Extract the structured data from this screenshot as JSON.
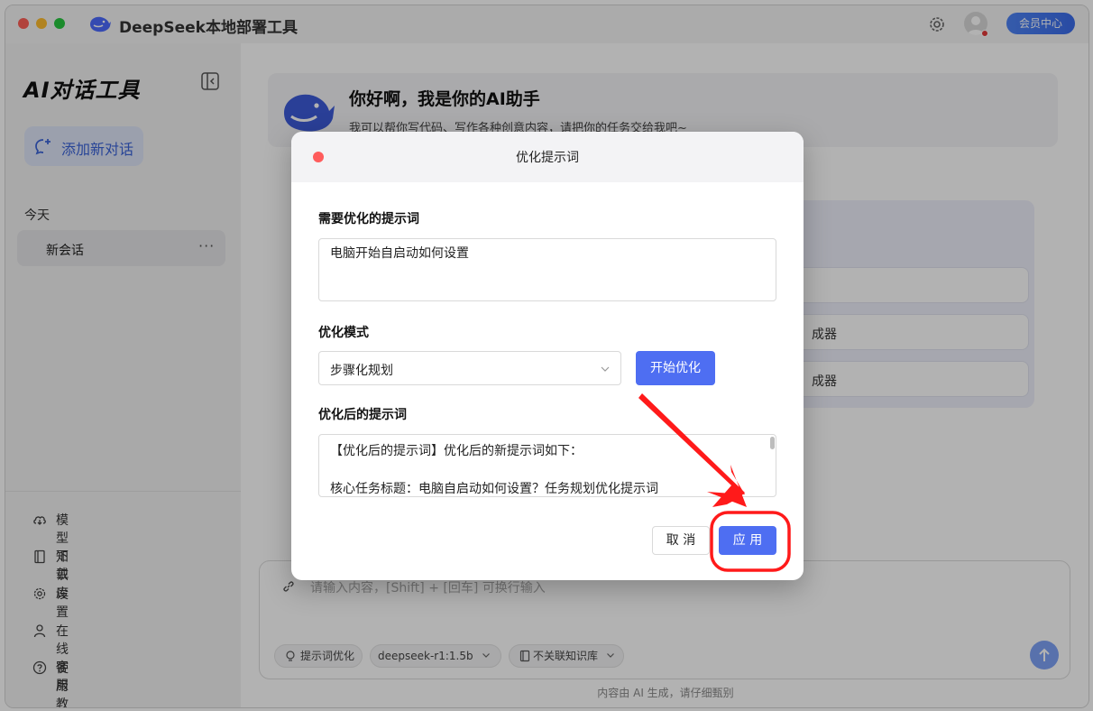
{
  "app": {
    "title": "DeepSeek本地部署工具",
    "vip_label": "会员中心"
  },
  "sidebar": {
    "title": "AI对话工具",
    "new_chat_label": "添加新对话",
    "group_label": "今天",
    "sessions": [
      {
        "label": "新会话",
        "more": "···"
      }
    ],
    "menu": [
      {
        "label": "模型下载",
        "icon": "cloud-download-icon"
      },
      {
        "label": "知识库",
        "icon": "book-icon"
      },
      {
        "label": "设置",
        "icon": "gear-icon"
      },
      {
        "label": "在线客服",
        "icon": "user-icon"
      },
      {
        "label": "使用教程",
        "icon": "help-icon"
      }
    ]
  },
  "main": {
    "welcome_title": "你好啊，我是你的AI助手",
    "welcome_subtitle": "我可以帮你写代码、写作各种创意内容，请把你的任务交给我吧~",
    "suggestions": [
      "成器",
      "成器"
    ],
    "input_placeholder": "请输入内容，[Shift] + [回车] 可换行输入",
    "chips": {
      "prompt_opt": "提示词优化",
      "model": "deepseek-r1:1.5b",
      "knowledge": "不关联知识库"
    },
    "footer_note": "内容由 AI 生成，请仔细甄别"
  },
  "modal": {
    "title": "优化提示词",
    "prompt_label": "需要优化的提示词",
    "prompt_value": "电脑开始自启动如何设置",
    "mode_label": "优化模式",
    "mode_value": "步骤化规划",
    "start_label": "开始优化",
    "result_label": "优化后的提示词",
    "result_lines": [
      "【优化后的提示词】优化后的新提示词如下：",
      "核心任务标题：电脑自启动如何设置？任务规划优化提示词"
    ],
    "cancel_label": "取 消",
    "apply_label": "应 用"
  },
  "colors": {
    "accent": "#4e6ef2",
    "annotation": "#ff1a1a"
  }
}
